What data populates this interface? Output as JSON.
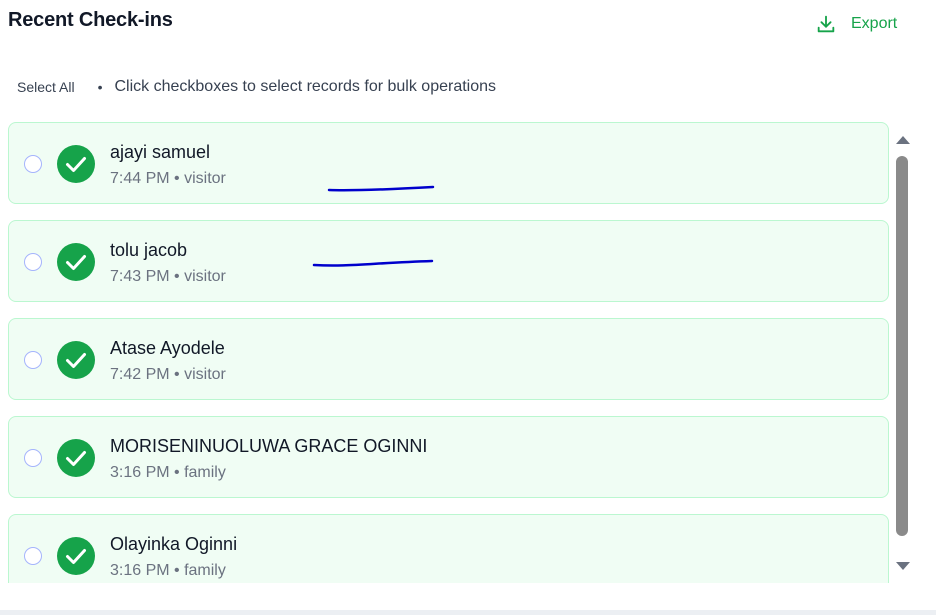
{
  "header": {
    "title": "Recent Check-ins",
    "export_label": "Export",
    "export_icon": "download-icon"
  },
  "toolbar": {
    "select_all_label": "Select All",
    "separator": "•",
    "hint": "Click checkboxes to select records for bulk operations"
  },
  "colors": {
    "accent": "#16a34a",
    "card_bg": "#f0fdf4",
    "card_border": "#bbf7d0",
    "annotation_ink": "#0000cc"
  },
  "checkins": [
    {
      "name": "ajayi samuel",
      "time": "7:44 PM",
      "type": "visitor",
      "meta": "7:44 PM • visitor",
      "status_icon": "check-circle-icon",
      "selected": false
    },
    {
      "name": "tolu jacob",
      "time": "7:43 PM",
      "type": "visitor",
      "meta": "7:43 PM • visitor",
      "status_icon": "check-circle-icon",
      "selected": false
    },
    {
      "name": "Atase Ayodele",
      "time": "7:42 PM",
      "type": "visitor",
      "meta": "7:42 PM • visitor",
      "status_icon": "check-circle-icon",
      "selected": false
    },
    {
      "name": "MORISENINUOLUWA GRACE OGINNI",
      "time": "3:16 PM",
      "type": "family",
      "meta": "3:16 PM • family",
      "status_icon": "check-circle-icon",
      "selected": false
    },
    {
      "name": "Olayinka Oginni",
      "time": "3:16 PM",
      "type": "family",
      "meta": "3:16 PM • family",
      "status_icon": "check-circle-icon",
      "selected": false
    }
  ]
}
